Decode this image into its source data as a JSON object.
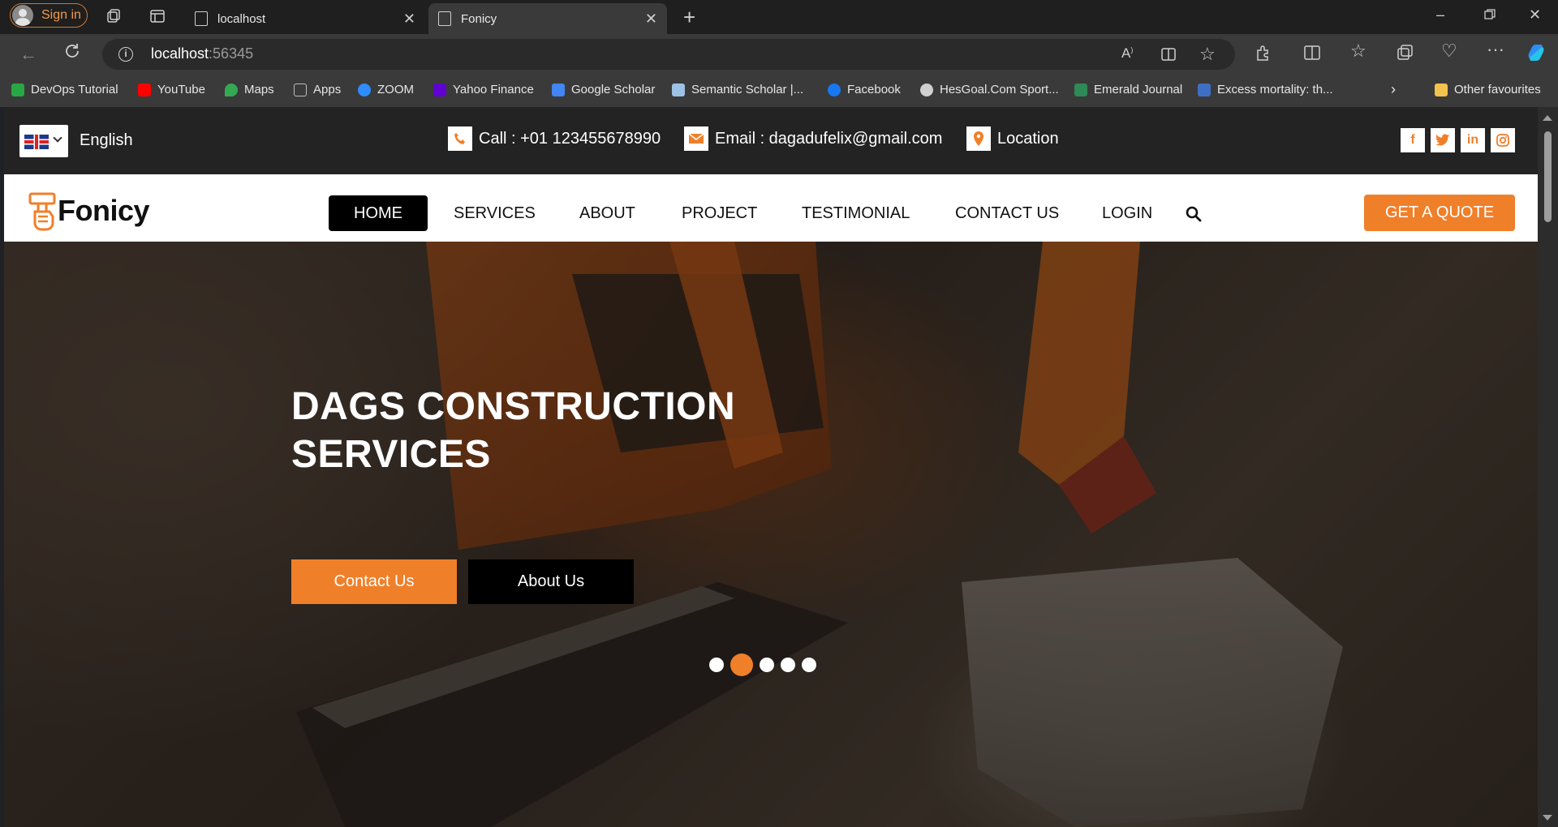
{
  "browser": {
    "sign_in_label": "Sign in",
    "tabs": [
      {
        "title": "localhost"
      },
      {
        "title": "Fonicy"
      }
    ],
    "address": {
      "host": "localhost",
      "port": ":56345"
    },
    "bookmarks": [
      {
        "label": "DevOps Tutorial",
        "color": "#27a844"
      },
      {
        "label": "YouTube",
        "color": "#ff0000"
      },
      {
        "label": "Maps",
        "color": "#34a853"
      },
      {
        "label": "Apps",
        "color": "#bdbdbd"
      },
      {
        "label": "ZOOM",
        "color": "#2d8cff"
      },
      {
        "label": "Yahoo Finance",
        "color": "#6001d2"
      },
      {
        "label": "Google Scholar",
        "color": "#4285f4"
      },
      {
        "label": "Semantic Scholar |...",
        "color": "#9ec1e6"
      },
      {
        "label": "Facebook",
        "color": "#1877f2"
      },
      {
        "label": "HesGoal.Com Sport...",
        "color": "#d0d0d0"
      },
      {
        "label": "Emerald Journal",
        "color": "#2e8b57"
      },
      {
        "label": "Excess mortality: th...",
        "color": "#3f6fc4"
      },
      {
        "label": "Other favourites",
        "color": "#f2c24e"
      }
    ]
  },
  "topbar": {
    "language": "English",
    "phone": "Call : +01 123455678990",
    "email": "Email : dagadufelix@gmail.com",
    "location": "Location",
    "social": [
      "f",
      "t",
      "in",
      "ig"
    ]
  },
  "nav": {
    "brand": "Fonicy",
    "items": [
      "HOME",
      "SERVICES",
      "ABOUT",
      "PROJECT",
      "TESTIMONIAL",
      "CONTACT US",
      "LOGIN"
    ],
    "quote_label": "GET A QUOTE"
  },
  "hero": {
    "headline": "DAGS CONSTRUCTION SERVICES",
    "contact_btn": "Contact Us",
    "about_btn": "About Us",
    "slide_count": 5,
    "active_slide": 2
  },
  "colors": {
    "accent": "#f07f2a",
    "topbar_bg": "#232323",
    "nav_active_bg": "#000000"
  }
}
